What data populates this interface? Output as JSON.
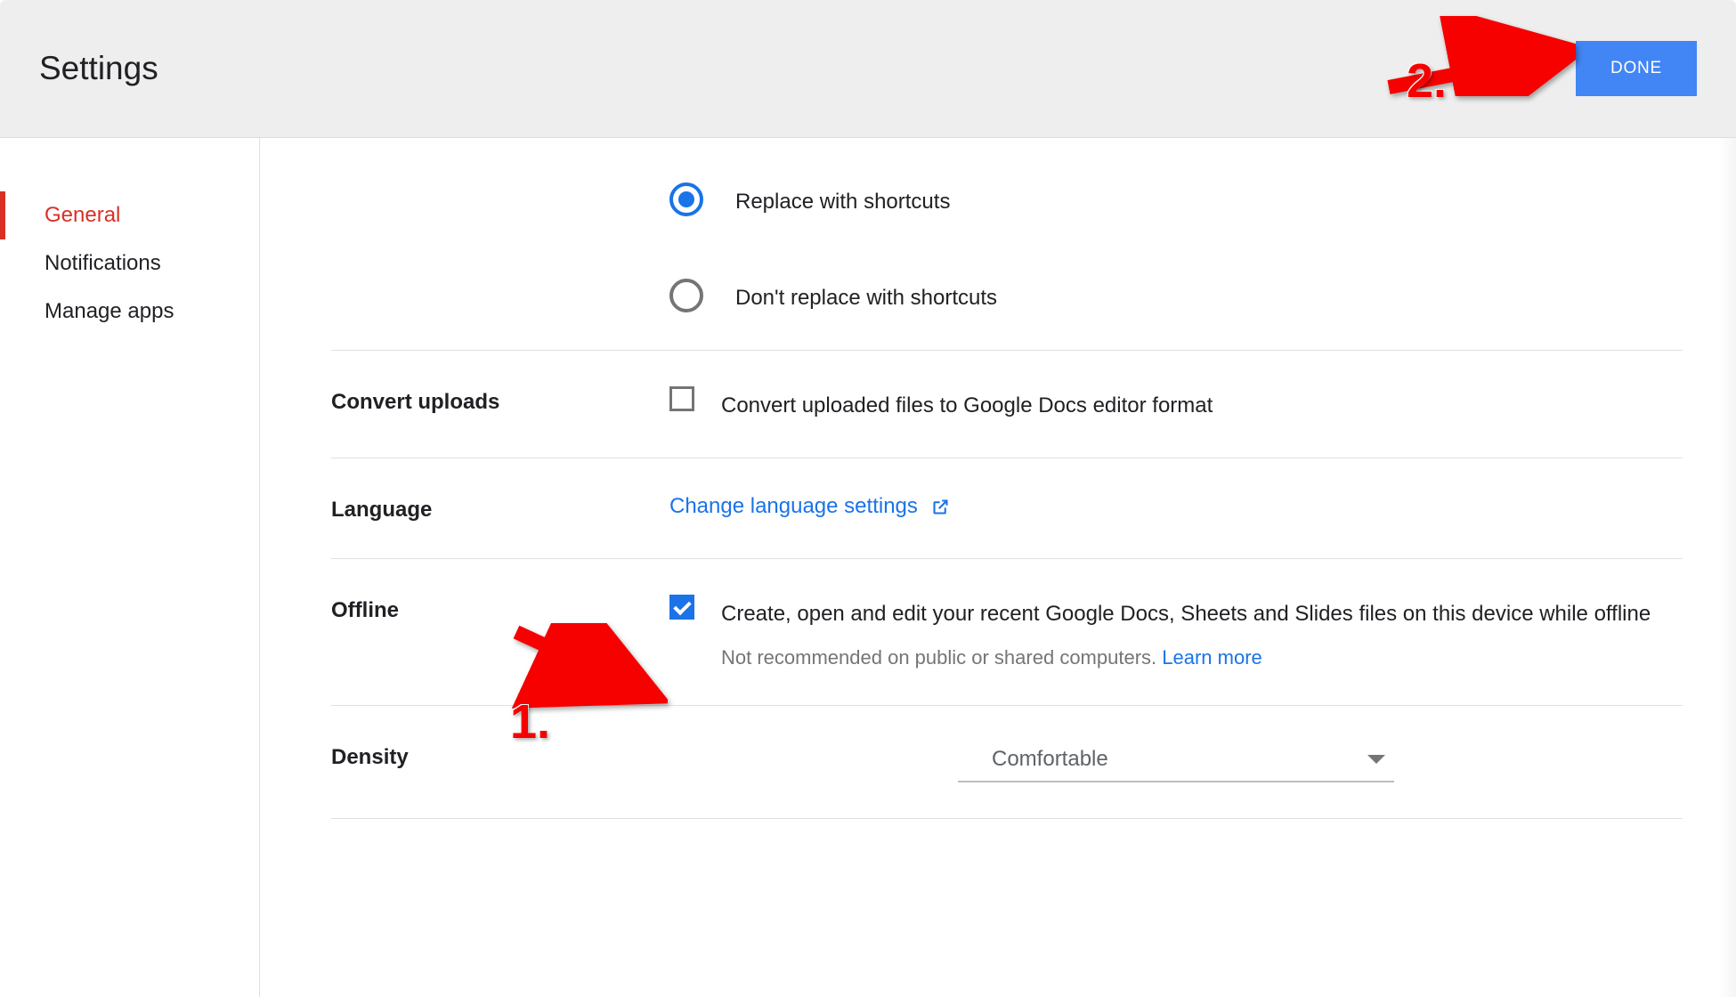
{
  "header": {
    "title": "Settings",
    "done_label": "DONE"
  },
  "sidebar": {
    "items": [
      {
        "label": "General",
        "active": true
      },
      {
        "label": "Notifications",
        "active": false
      },
      {
        "label": "Manage apps",
        "active": false
      }
    ]
  },
  "sections": {
    "shortcuts": {
      "options": [
        {
          "label": "Replace with shortcuts",
          "checked": true
        },
        {
          "label": "Don't replace with shortcuts",
          "checked": false
        }
      ]
    },
    "convert_uploads": {
      "title": "Convert uploads",
      "option_label": "Convert uploaded files to Google Docs editor format",
      "checked": false
    },
    "language": {
      "title": "Language",
      "link_label": "Change language settings"
    },
    "offline": {
      "title": "Offline",
      "option_label": "Create, open and edit your recent Google Docs, Sheets and Slides files on this device while offline",
      "checked": true,
      "subtext": "Not recommended on public or shared computers. ",
      "learn_more": "Learn more"
    },
    "density": {
      "title": "Density",
      "selected": "Comfortable"
    }
  },
  "annotations": {
    "step1": "1.",
    "step2": "2."
  }
}
